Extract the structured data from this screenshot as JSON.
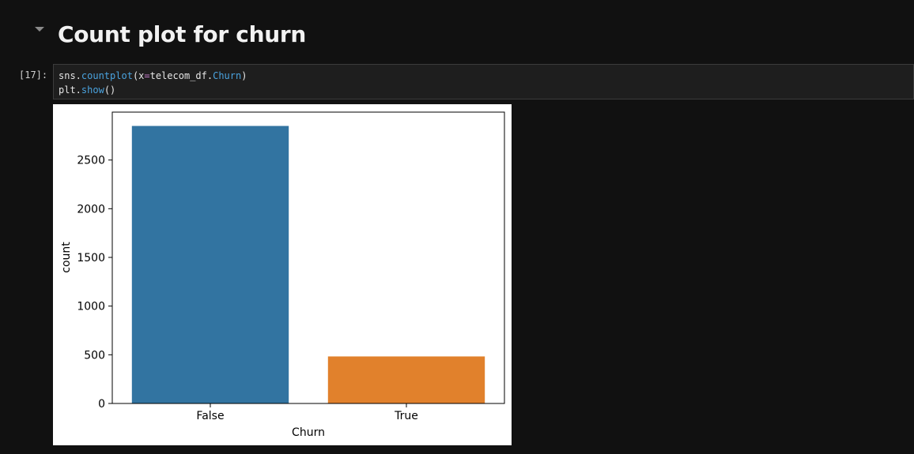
{
  "heading": {
    "text": "Count plot for churn",
    "icon": "chevron-down-icon"
  },
  "cell": {
    "prompt": "[17]:",
    "code": {
      "line1": {
        "a": "sns.",
        "b": "countplot",
        "c": "(x",
        "d": "=",
        "e": "telecom_df.",
        "f": "Churn",
        "g": ")"
      },
      "line2": {
        "a": "plt.",
        "b": "show",
        "c": "()"
      }
    }
  },
  "colors": {
    "background": "#111111",
    "cell_bg": "#1e1e1e",
    "false_bar": "#3274a1",
    "true_bar": "#e1812c",
    "function": "#4aa3df"
  },
  "chart_data": {
    "type": "bar",
    "categories": [
      "False",
      "True"
    ],
    "values": [
      2850,
      483
    ],
    "xlabel": "Churn",
    "ylabel": "count",
    "ylim": [
      0,
      2992
    ],
    "yticks": [
      0,
      500,
      1000,
      1500,
      2000,
      2500
    ],
    "bar_colors": [
      "#3274a1",
      "#e1812c"
    ],
    "grid": false
  }
}
